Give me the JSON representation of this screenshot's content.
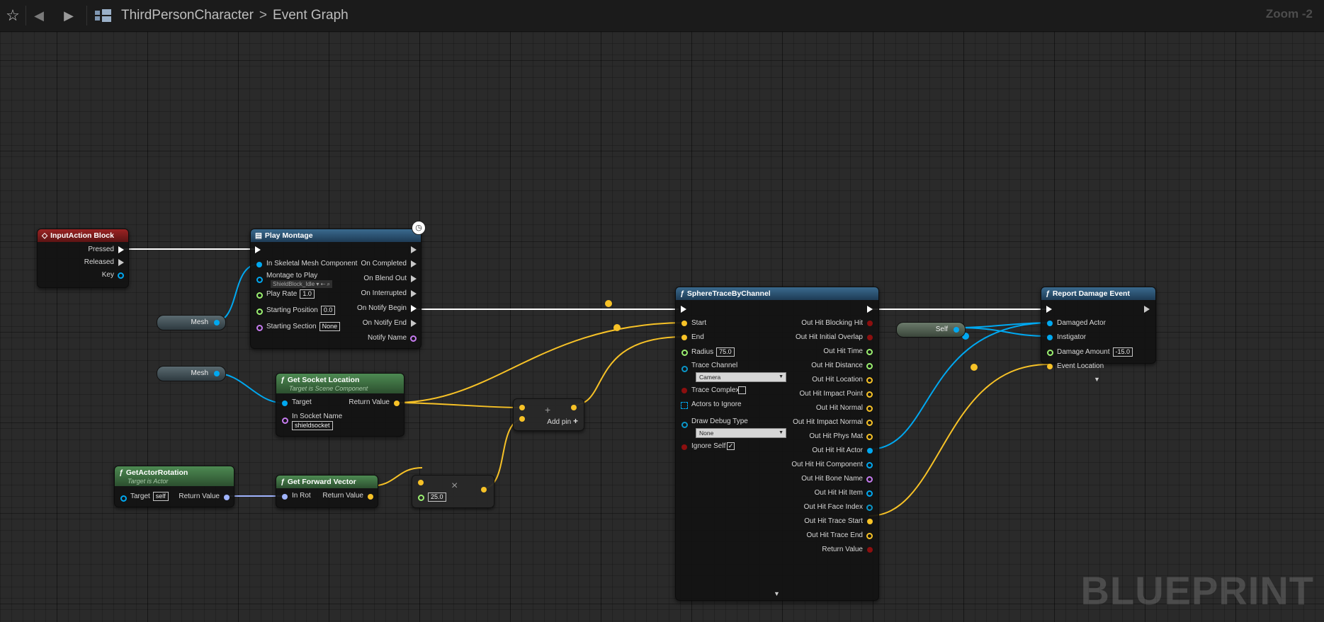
{
  "toolbar": {
    "favorite": "☆",
    "back": "◀",
    "forward": "▶"
  },
  "breadcrumb": {
    "blueprint": "ThirdPersonCharacter",
    "separator": ">",
    "graph": "Event Graph"
  },
  "zoom": "Zoom -2",
  "watermark": "BLUEPRINT",
  "colors": {
    "exec": "#ffffff",
    "object": "#00a8f0",
    "vector": "#f7c227",
    "float": "#9bf070",
    "name": "#c77cf0",
    "bool": "#8c0f0f",
    "rotator": "#a0b4ff",
    "struct": "#0a96c8"
  },
  "nodes": {
    "input_action": {
      "title": "InputAction Block",
      "pressed": "Pressed",
      "released": "Released",
      "key": "Key"
    },
    "play_montage": {
      "title": "Play Montage",
      "in_mesh": "In Skeletal Mesh Component",
      "montage": "Montage to Play",
      "montage_value": "ShieldBlock_Idle",
      "play_rate": "Play Rate",
      "play_rate_value": "1.0",
      "start_pos": "Starting Position",
      "start_pos_value": "0.0",
      "start_section": "Starting Section",
      "start_section_value": "None",
      "on_completed": "On Completed",
      "on_blend_out": "On Blend Out",
      "on_interrupted": "On Interrupted",
      "on_notify_begin": "On Notify Begin",
      "on_notify_end": "On Notify End",
      "notify_name": "Notify Name"
    },
    "mesh1": {
      "label": "Mesh"
    },
    "mesh2": {
      "label": "Mesh"
    },
    "socket": {
      "title": "Get Socket Location",
      "subtitle": "Target is Scene Component",
      "target": "Target",
      "return_value": "Return Value",
      "socket_name": "In Socket Name",
      "socket_value": "shieldsocket"
    },
    "actor_rot": {
      "title": "GetActorRotation",
      "subtitle": "Target is Actor",
      "target": "Target",
      "target_value": "self",
      "return_value": "Return Value"
    },
    "fwd": {
      "title": "Get Forward Vector",
      "in_rot": "In Rot",
      "return_value": "Return Value"
    },
    "multiply": {
      "symbol": "×",
      "value": "25.0"
    },
    "add": {
      "symbol": "+",
      "add_pin": "Add pin"
    },
    "sphere": {
      "title": "SphereTraceByChannel",
      "start": "Start",
      "end": "End",
      "radius": "Radius",
      "radius_value": "75.0",
      "trace_channel": "Trace Channel",
      "trace_channel_value": "Camera",
      "trace_complex": "Trace Complex",
      "actors_ignore": "Actors to Ignore",
      "draw_debug": "Draw Debug Type",
      "draw_debug_value": "None",
      "ignore_self": "Ignore Self",
      "outputs": [
        "Out Hit Blocking Hit",
        "Out Hit Initial Overlap",
        "Out Hit Time",
        "Out Hit Distance",
        "Out Hit Location",
        "Out Hit Impact Point",
        "Out Hit Normal",
        "Out Hit Impact Normal",
        "Out Hit Phys Mat",
        "Out Hit Hit Actor",
        "Out Hit Hit Component",
        "Out Hit Bone Name",
        "Out Hit Hit Item",
        "Out Hit Face Index",
        "Out Hit Trace Start",
        "Out Hit Trace End",
        "Return Value"
      ]
    },
    "self": {
      "label": "Self"
    },
    "report": {
      "title": "Report Damage Event",
      "damaged_actor": "Damaged Actor",
      "instigator": "Instigator",
      "damage_amount": "Damage Amount",
      "damage_value": "-15.0",
      "event_location": "Event Location"
    }
  }
}
